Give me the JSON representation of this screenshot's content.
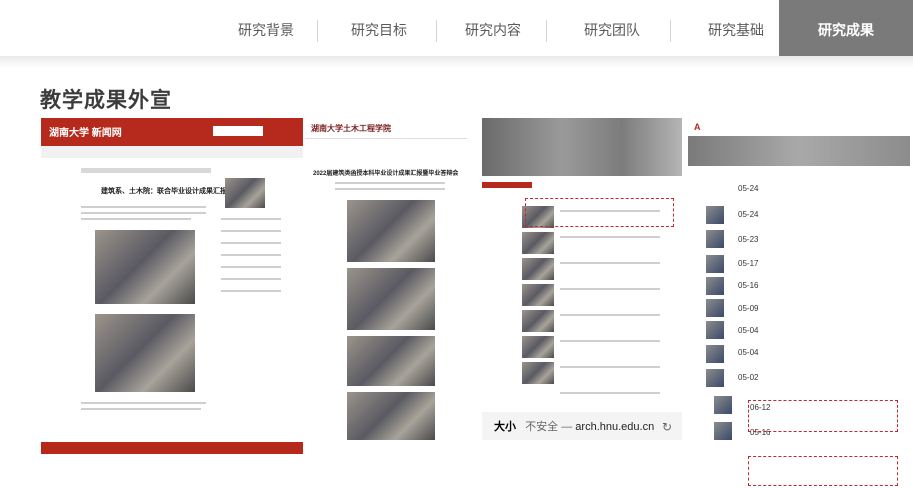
{
  "nav": {
    "items": [
      {
        "label": "研究背景"
      },
      {
        "label": "研究目标"
      },
      {
        "label": "研究内容"
      },
      {
        "label": "研究团队"
      },
      {
        "label": "研究基础"
      },
      {
        "label": "研究成果"
      }
    ],
    "active": "研究成果"
  },
  "section": {
    "title": "教学成果外宣"
  },
  "shot1": {
    "site": "湖南大学 新闻网",
    "headline": "建筑系、土木院：联合毕业设计成果汇报会举行"
  },
  "shot2": {
    "site": "湖南大学土木工程学院",
    "headline": "2022届建筑类函授本科毕业设计成果汇报暨毕业答辩会"
  },
  "shot3": {
    "aa": "大小",
    "insecure": "不安全",
    "dash": "—",
    "url": "arch.hnu.edu.cn",
    "reload": "↻"
  },
  "shot4": {
    "dates": [
      "05-24",
      "05-24",
      "05-23",
      "05-17",
      "05-16",
      "05-09",
      "05-04",
      "05-04",
      "05-02",
      "06-12",
      "05-16"
    ]
  },
  "colors": {
    "accent": "#b52a1d",
    "nav_active": "#7a7a7a",
    "highlight": "#c0282e"
  }
}
